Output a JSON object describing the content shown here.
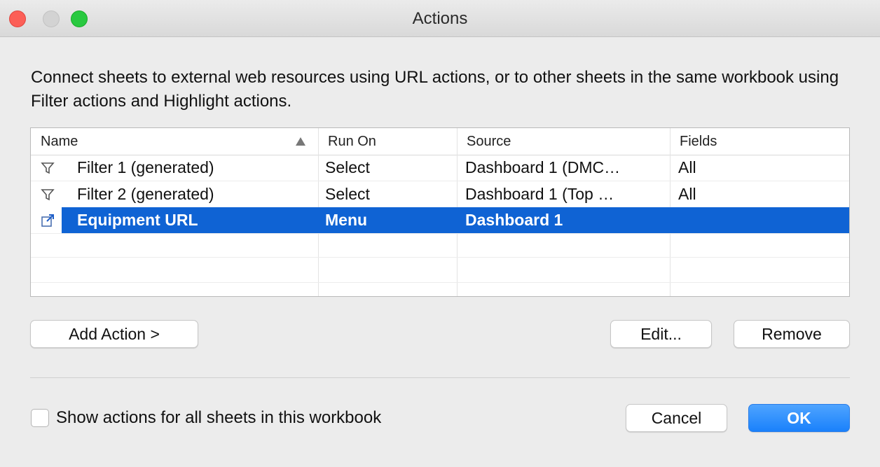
{
  "window": {
    "title": "Actions"
  },
  "description": "Connect sheets to external web resources using URL actions, or to other sheets in the same workbook using Filter actions and Highlight actions.",
  "table": {
    "columns": [
      "Name",
      "Run On",
      "Source",
      "Fields"
    ],
    "rows": [
      {
        "icon": "filter-icon",
        "name": "Filter 1 (generated)",
        "run_on": "Select",
        "source": "Dashboard 1 (DMC…",
        "fields": "All"
      },
      {
        "icon": "filter-icon",
        "name": "Filter 2 (generated)",
        "run_on": "Select",
        "source": "Dashboard 1 (Top …",
        "fields": "All"
      },
      {
        "icon": "url-link-icon",
        "name": "Equipment URL",
        "run_on": "Menu",
        "source": "Dashboard 1",
        "fields": "",
        "selected": true
      }
    ]
  },
  "buttons": {
    "add_action": "Add Action >",
    "edit": "Edit...",
    "remove": "Remove",
    "cancel": "Cancel",
    "ok": "OK"
  },
  "checkbox": {
    "label": "Show actions for all sheets in this workbook",
    "checked": false
  },
  "colors": {
    "selection": "#0f63d4",
    "primary_button": "#1a81fb"
  }
}
